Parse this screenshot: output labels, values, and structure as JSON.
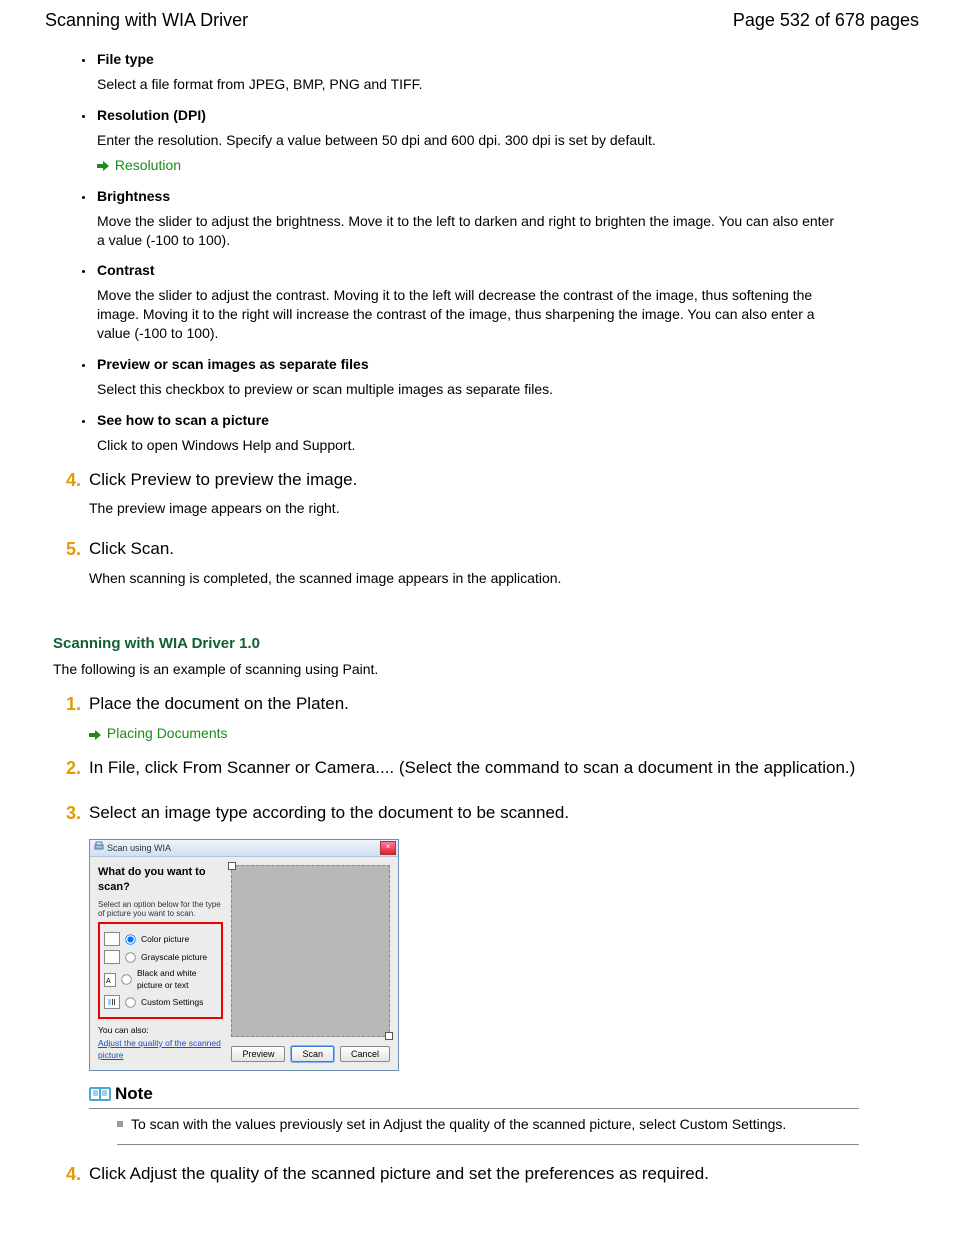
{
  "header": {
    "title": "Scanning with WIA Driver",
    "page_indicator": "Page 532 of 678 pages"
  },
  "bullet_items": [
    {
      "title": "File type",
      "body": "Select a file format from JPEG, BMP, PNG and TIFF."
    },
    {
      "title": "Resolution (DPI)",
      "body": "Enter the resolution. Specify a value between 50 dpi and 600 dpi. 300 dpi is set by default.",
      "link": "Resolution"
    },
    {
      "title": "Brightness",
      "body": "Move the slider to adjust the brightness. Move it to the left to darken and right to brighten the image. You can also enter a value (-100 to 100)."
    },
    {
      "title": "Contrast",
      "body": "Move the slider to adjust the contrast. Moving it to the left will decrease the contrast of the image, thus softening the image. Moving it to the right will increase the contrast of the image, thus sharpening the image. You can also enter a value (-100 to 100)."
    },
    {
      "title": "Preview or scan images as separate files",
      "body": "Select this checkbox to preview or scan multiple images as separate files."
    },
    {
      "title": "See how to scan a picture",
      "body": "Click to open Windows Help and Support."
    }
  ],
  "steps_a": [
    {
      "num": "4.",
      "head": "Click Preview to preview the image.",
      "sub": "The preview image appears on the right."
    },
    {
      "num": "5.",
      "head": "Click Scan.",
      "sub": "When scanning is completed, the scanned image appears in the application."
    }
  ],
  "section": {
    "title": "Scanning with WIA Driver 1.0",
    "intro": "The following is an example of scanning using Paint."
  },
  "steps_b": {
    "s1": {
      "num": "1.",
      "head": "Place the document on the Platen.",
      "link": "Placing Documents"
    },
    "s2": {
      "num": "2.",
      "head": "In File, click From Scanner or Camera.... (Select the command to scan a document in the application.)"
    },
    "s3": {
      "num": "3.",
      "head": "Select an image type according to the document to be scanned."
    },
    "s4": {
      "num": "4.",
      "head": "Click Adjust the quality of the scanned picture and set the preferences as required."
    }
  },
  "dialog": {
    "title": "Scan using WIA",
    "prompt": "What do you want to scan?",
    "subprompt": "Select an option below for the type of picture you want to scan.",
    "options": {
      "o1": "Color picture",
      "o2": "Grayscale picture",
      "o3": "Black and white picture or text",
      "o4": "Custom Settings"
    },
    "youcan": "You can also:",
    "adjust_link": "Adjust the quality of the scanned picture",
    "buttons": {
      "preview": "Preview",
      "scan": "Scan",
      "cancel": "Cancel"
    }
  },
  "note": {
    "label": "Note",
    "item": "To scan with the values previously set in Adjust the quality of the scanned picture, select Custom Settings."
  }
}
